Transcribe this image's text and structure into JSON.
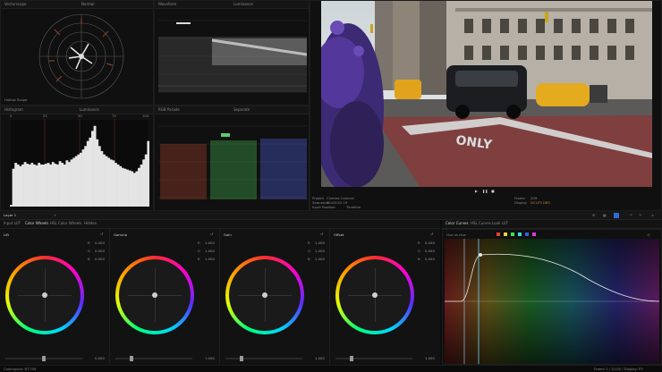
{
  "scopes": {
    "vectorscope": {
      "title": "Vectorscope",
      "mode": "Normal",
      "footer": "Hollow Scope"
    },
    "waveform": {
      "title": "Waveform",
      "mode": "Luminance"
    },
    "histogram": {
      "title": "Histogram",
      "mode": "Luminance",
      "ticks": [
        "0",
        "25",
        "50",
        "75",
        "100"
      ],
      "levels": [
        0.02,
        0.45,
        0.52,
        0.5,
        0.48,
        0.5,
        0.53,
        0.51,
        0.5,
        0.52,
        0.5,
        0.49,
        0.52,
        0.5,
        0.5,
        0.51,
        0.52,
        0.5,
        0.53,
        0.51,
        0.5,
        0.54,
        0.52,
        0.5,
        0.55,
        0.53,
        0.56,
        0.58,
        0.6,
        0.62,
        0.64,
        0.68,
        0.72,
        0.78,
        0.82,
        0.9,
        0.96,
        0.8,
        0.72,
        0.66,
        0.62,
        0.6,
        0.58,
        0.56,
        0.55,
        0.52,
        0.5,
        0.48,
        0.46,
        0.45,
        0.44,
        0.43,
        0.42,
        0.4,
        0.42,
        0.46,
        0.5,
        0.56,
        0.62,
        0.78
      ]
    },
    "rgb_parade": {
      "title": "RGB Parade",
      "mode": "Separate"
    }
  },
  "viewer": {
    "info_left": [
      "Project",
      "Sequence",
      "Input Position"
    ],
    "info_mid": [
      "Cinema Camera",
      "00:00:52:19",
      "Timeline"
    ],
    "info_right": [
      "Frame",
      "Display"
    ],
    "info_right_vals": [
      "209",
      "DCI-P3 D65"
    ],
    "street_text": "ONLY"
  },
  "tabs": {
    "left": [
      "Input LUT",
      "Color Wheels",
      "HSL Color Wheels",
      "Hidden"
    ],
    "right": [
      "Color Curves",
      "HSL Curves",
      "Look LUT"
    ],
    "left_active": 1,
    "right_active": 0,
    "layer_label": "Layer 1"
  },
  "wheels": [
    {
      "name": "Lift",
      "vals": [
        "0.000",
        "0.000",
        "0.000"
      ],
      "footer": "0.000"
    },
    {
      "name": "Gamma",
      "vals": [
        "1.000",
        "1.000",
        "1.000"
      ],
      "footer": "1.000"
    },
    {
      "name": "Gain",
      "vals": [
        "1.000",
        "1.000",
        "1.000"
      ],
      "footer": "1.000"
    },
    {
      "name": "Offset",
      "vals": [
        "0.000",
        "0.000",
        "0.000"
      ],
      "footer": "1.000"
    }
  ],
  "channel_labels": [
    "R",
    "G",
    "B"
  ],
  "curves": {
    "mode": "Hue vs Hue"
  },
  "status": {
    "left": "Colorspace: BT.709",
    "right": "Frame 1 / 12:00 / Display: P3"
  },
  "colors": {
    "accent": "#2f6bd6",
    "panel": "#101010",
    "active_tab": "#d6d6d6"
  }
}
